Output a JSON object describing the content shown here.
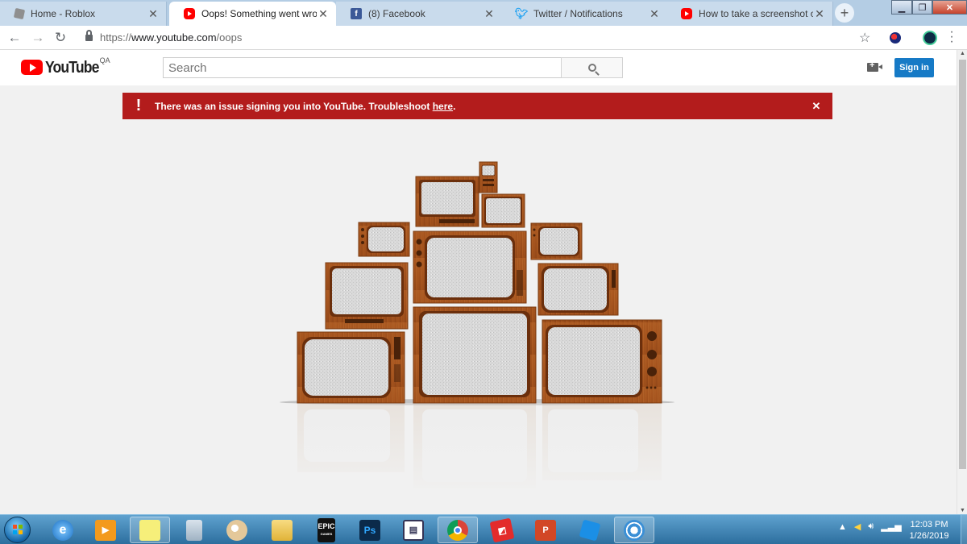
{
  "browser": {
    "tabs": [
      {
        "title": "Home - Roblox",
        "icon": "roblox-icon"
      },
      {
        "title": "Oops! Something went wrong.",
        "icon": "youtube-icon"
      },
      {
        "title": "(8) Facebook",
        "icon": "facebook-icon"
      },
      {
        "title": "Twitter / Notifications",
        "icon": "twitter-icon"
      },
      {
        "title": "How to take a screenshot on a",
        "icon": "youtube-icon"
      }
    ],
    "active_tab": 1,
    "url_scheme": "https://",
    "url_host": "www.youtube.com",
    "url_path": "/oops"
  },
  "youtube": {
    "logo_text": "YouTube",
    "logo_suffix": "QA",
    "search_placeholder": "Search",
    "signin_label": "Sign in",
    "brand_red": "#ff0000",
    "signin_blue": "#167ac6"
  },
  "alert": {
    "message_prefix": "There was an issue signing you into YouTube. Troubleshoot ",
    "link_text": "here",
    "message_suffix": ".",
    "background": "#b31c1c"
  },
  "taskbar": {
    "apps": [
      "internet-explorer",
      "media-player",
      "sticky-notes",
      "calculator",
      "paint",
      "file-explorer",
      "epic-games-launcher",
      "photoshop",
      "task-app",
      "chrome",
      "roblox-studio",
      "powerpoint",
      "roblox",
      "bittorrent"
    ],
    "epic_label": "EPIC",
    "epic_sublabel": "GAMES",
    "ps_label": "Ps",
    "ppt_label": "P",
    "time": "12:03 PM",
    "date": "1/26/2019"
  }
}
